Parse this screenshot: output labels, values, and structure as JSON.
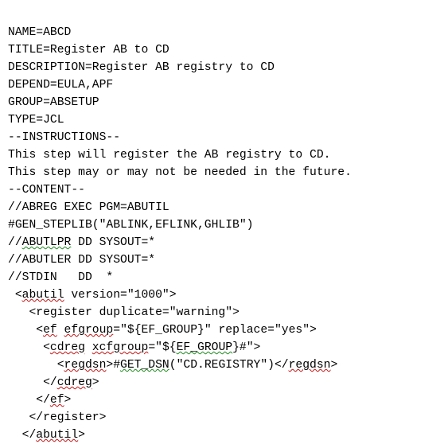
{
  "lines": {
    "l1": "NAME=ABCD",
    "l2": "TITLE=Register AB to CD",
    "l3": "DESCRIPTION=Register AB registry to CD",
    "l4": "DEPEND=EULA,APF",
    "l5": "GROUP=ABSETUP",
    "l6": "TYPE=JCL",
    "l7": "--INSTRUCTIONS--",
    "l8": "This step will register the AB registry to CD.",
    "l9": "This step may or may not be needed in the future.",
    "l10": "--CONTENT--",
    "l11": "//ABREG EXEC PGM=ABUTIL",
    "l12": "#GEN_STEPLIB(\"ABLINK,EFLINK,GHLIB\")",
    "l13a": "//",
    "l13b": "ABUTLPR",
    "l13c": " DD SYSOUT=*",
    "l14": "//ABUTLER DD SYSOUT=*",
    "l15": "//STDIN   DD  *",
    "l16a": " <",
    "l16b": "abutil",
    "l16c": " version=\"1000\">",
    "l17": "   <register duplicate=\"warning\">",
    "l18a": "    <",
    "l18b": "ef",
    "l18c": " ",
    "l18d": "efgroup",
    "l18e": "=\"${EF_GROUP}\" replace=\"yes\">",
    "l19a": "     <",
    "l19b": "cdreg",
    "l19c": " ",
    "l19d": "xcfgroup",
    "l19e": "=\"${",
    "l19f": "EF_GROUP",
    "l19g": "}#\">",
    "l20a": "       <",
    "l20b": "regdsn",
    "l20c": ">#",
    "l20d": "GET_DSN",
    "l20e": "(\"CD.REGISTRY\")</",
    "l20f": "regdsn",
    "l20g": ">",
    "l21a": "     </",
    "l21b": "cdreg",
    "l21c": ">",
    "l22a": "    </",
    "l22b": "ef",
    "l22c": ">",
    "l23": "   </register>",
    "l24a": "  </",
    "l24b": "abutil",
    "l24c": ">"
  }
}
